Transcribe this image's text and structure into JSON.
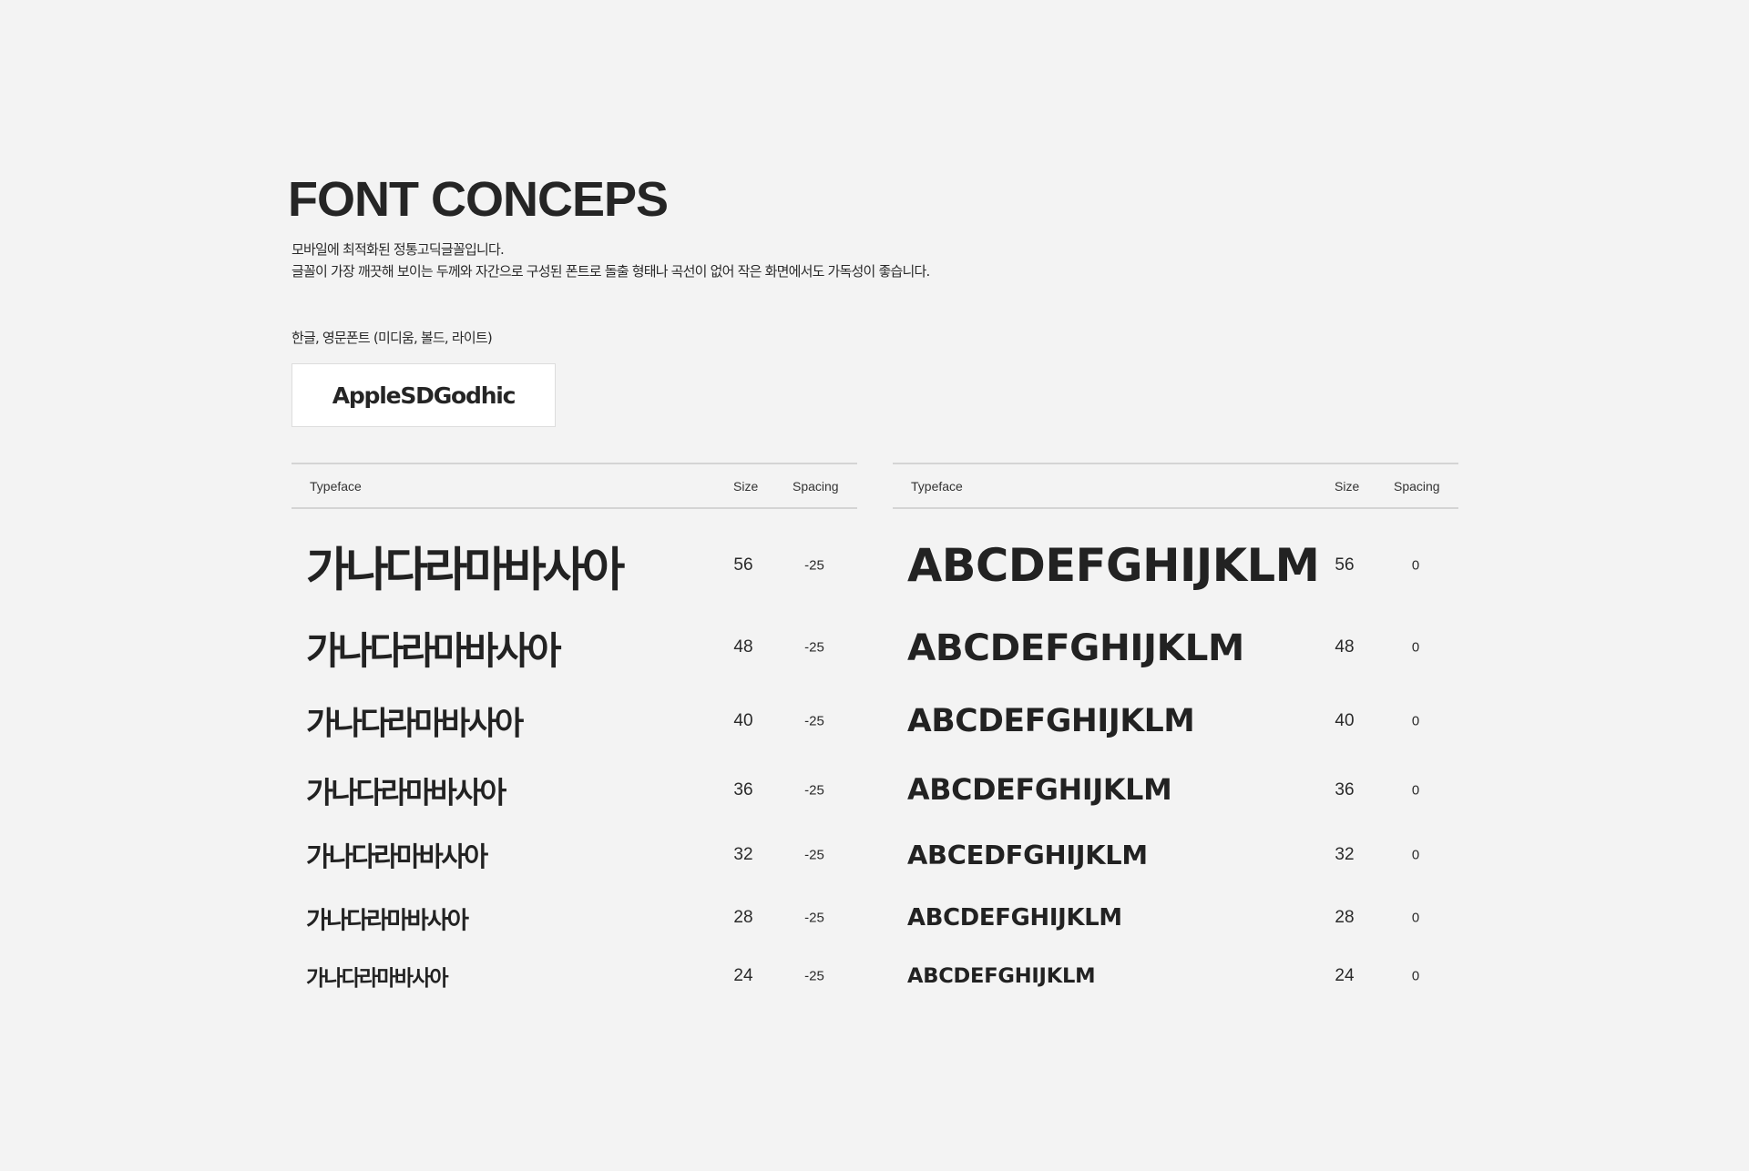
{
  "page": {
    "title": "FONT CONCEPS",
    "description": [
      "모바일에 최적화된 정통고딕글꼴입니다.",
      "글꼴이 가장 깨끗해 보이는 두께와 자간으로 구성된 폰트로 돌출 형태나 곡선이 없어 작은 화면에서도 가독성이 좋습니다."
    ],
    "font_note": "한글, 영문폰트 (미디움, 볼드, 라이트)",
    "font_name": "AppleSDGodhic"
  },
  "tables": [
    {
      "headers": {
        "typeface": "Typeface",
        "size": "Size",
        "spacing": "Spacing"
      },
      "rows": [
        {
          "sample": "가나다라마바사아",
          "size": "56",
          "spacing": "-25"
        },
        {
          "sample": "가나다라마바사아",
          "size": "48",
          "spacing": "-25"
        },
        {
          "sample": "가나다라마바사아",
          "size": "40",
          "spacing": "-25"
        },
        {
          "sample": "가나다라마바사아",
          "size": "36",
          "spacing": "-25"
        },
        {
          "sample": "가나다라마바사아",
          "size": "32",
          "spacing": "-25"
        },
        {
          "sample": "가나다라마바사아",
          "size": "28",
          "spacing": "-25"
        },
        {
          "sample": "가나다라마바사아",
          "size": "24",
          "spacing": "-25"
        }
      ]
    },
    {
      "headers": {
        "typeface": "Typeface",
        "size": "Size",
        "spacing": "Spacing"
      },
      "rows": [
        {
          "sample": "ABCDEFGHIJKLM",
          "size": "56",
          "spacing": "0"
        },
        {
          "sample": "ABCDEFGHIJKLM",
          "size": "48",
          "spacing": "0"
        },
        {
          "sample": "ABCDEFGHIJKLM",
          "size": "40",
          "spacing": "0"
        },
        {
          "sample": "ABCDEFGHIJKLM",
          "size": "36",
          "spacing": "0"
        },
        {
          "sample": "ABCEDFGHIJKLM",
          "size": "32",
          "spacing": "0"
        },
        {
          "sample": "ABCDEFGHIJKLM",
          "size": "28",
          "spacing": "0"
        },
        {
          "sample": "ABCDEFGHIJKLM",
          "size": "24",
          "spacing": "0"
        }
      ]
    }
  ]
}
